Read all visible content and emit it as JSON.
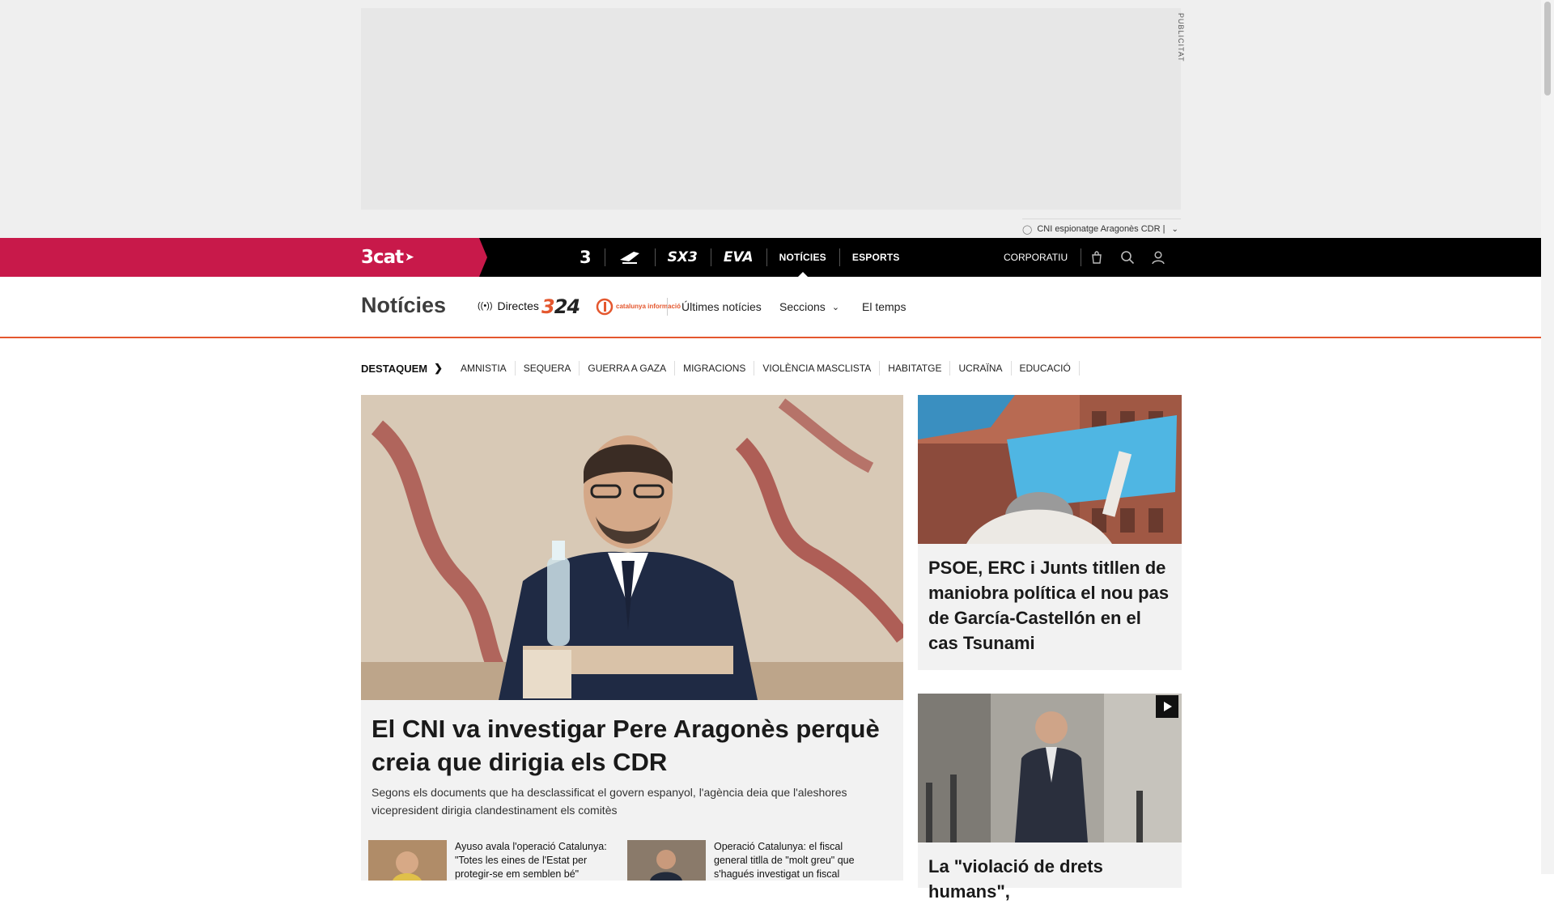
{
  "ad": {
    "label": "PUBLICITAT"
  },
  "trending": {
    "text": "CNI espionatge Aragonès CDR |"
  },
  "topnav": {
    "logo": "3cat",
    "channels": [
      {
        "label": "3",
        "icon": "tv3-logo"
      },
      {
        "label": "Cat ràdio",
        "icon": "catradio-logo"
      },
      {
        "label": "SX3",
        "icon": "sx3-logo"
      },
      {
        "label": "EVA",
        "icon": "eva-logo"
      },
      {
        "label": "NOTÍCIES",
        "active": true
      },
      {
        "label": "ESPORTS"
      }
    ],
    "corporatiu": "CORPORATIU",
    "icons": [
      "shopping-bag-icon",
      "search-icon",
      "user-icon"
    ]
  },
  "section": {
    "title": "Notícies",
    "directes": "Directes",
    "logo_324": "324",
    "logo_ci": "catalunya informació",
    "nav": {
      "ultimes": "Últimes notícies",
      "seccions": "Seccions",
      "temps": "El temps"
    }
  },
  "topics": {
    "label": "DESTAQUEM",
    "items": [
      "AMNISTIA",
      "SEQUERA",
      "GUERRA A GAZA",
      "MIGRACIONS",
      "VIOLÈNCIA MASCLISTA",
      "HABITATGE",
      "UCRAÏNA",
      "EDUCACIÓ"
    ]
  },
  "main": {
    "title": "El CNI va investigar Pere Aragonès perquè creia que dirigia els CDR",
    "summary": "Segons els documents que ha desclassificat el govern espanyol, l'agència deia que l'aleshores vicepresident dirigia clandestinament els comitès",
    "related": [
      {
        "text": "Ayuso avala l'operació Catalunya: \"Totes les eines de l'Estat per protegir-se em semblen bé\""
      },
      {
        "text": "Operació Catalunya: el fiscal general titlla de \"molt greu\" que s'hagués investigat un fiscal"
      }
    ]
  },
  "side": [
    {
      "title": "PSOE, ERC i Junts titllen de maniobra política el nou pas de García-Castellón en el cas Tsunami"
    },
    {
      "title": "La \"violació de drets humans\","
    }
  ],
  "colors": {
    "brand_pink": "#c8194a",
    "accent_orange": "#e4572e",
    "nav_black": "#000000"
  }
}
